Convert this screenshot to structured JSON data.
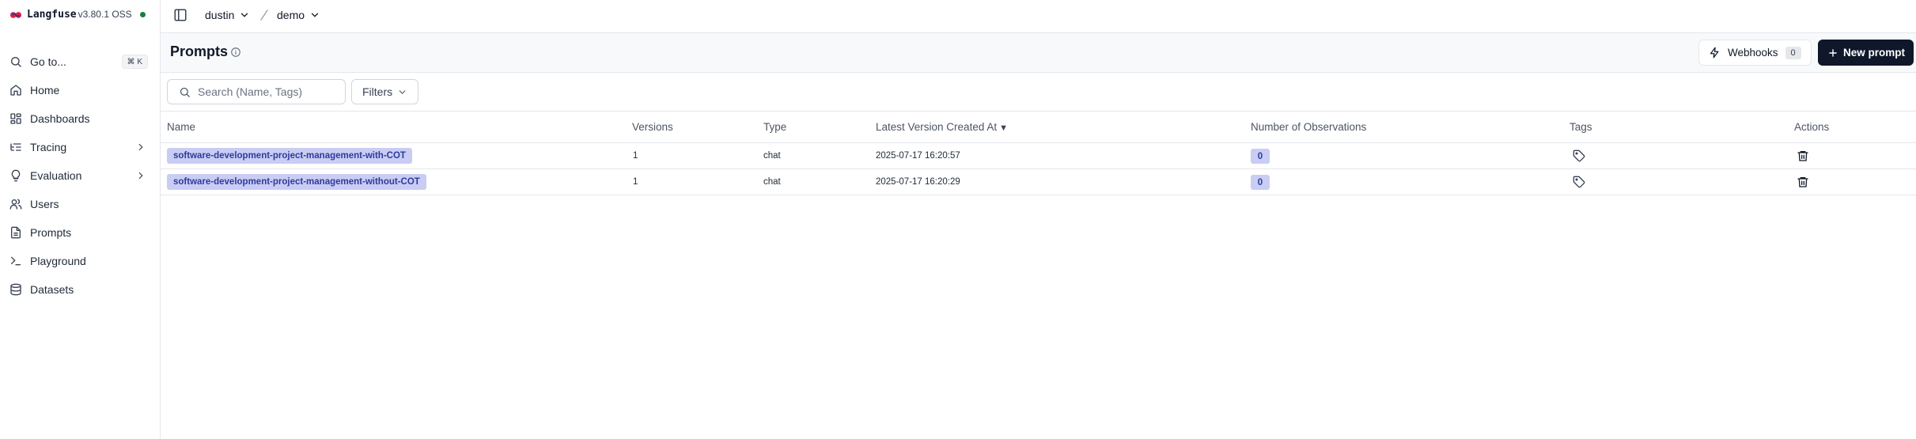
{
  "brand": {
    "name": "Langfuse",
    "version": "v3.80.1 OSS",
    "status_color": "#15803d",
    "logo_colors": [
      "#e11d48",
      "#1e3a8a"
    ]
  },
  "sidebar": {
    "items": [
      {
        "label": "Go to...",
        "icon": "search-icon",
        "shortcut": "⌘ K"
      },
      {
        "label": "Home",
        "icon": "home-icon"
      },
      {
        "label": "Dashboards",
        "icon": "grid-icon"
      },
      {
        "label": "Tracing",
        "icon": "list-tree-icon",
        "expandable": true
      },
      {
        "label": "Evaluation",
        "icon": "lightbulb-icon",
        "expandable": true
      },
      {
        "label": "Users",
        "icon": "users-icon"
      },
      {
        "label": "Prompts",
        "icon": "file-text-icon"
      },
      {
        "label": "Playground",
        "icon": "terminal-icon"
      },
      {
        "label": "Datasets",
        "icon": "database-icon"
      }
    ]
  },
  "topbar": {
    "organization": "dustin",
    "project": "demo"
  },
  "header": {
    "title": "Prompts",
    "webhooks_label": "Webhooks",
    "webhooks_count": "0",
    "new_prompt_label": "New prompt",
    "accent_color": "#0f172a"
  },
  "toolbar": {
    "search_placeholder": "Search (Name, Tags)",
    "search_value": "",
    "filters_label": "Filters"
  },
  "table": {
    "columns": {
      "name": "Name",
      "versions": "Versions",
      "type": "Type",
      "latest": "Latest Version Created At",
      "sort_indicator": "▼",
      "observations": "Number of Observations",
      "tags": "Tags",
      "actions": "Actions"
    },
    "rows": [
      {
        "name": "software-development-project-management-with-COT",
        "versions": "1",
        "type": "chat",
        "latest": "2025-07-17 16:20:57",
        "observations": "0"
      },
      {
        "name": "software-development-project-management-without-COT",
        "versions": "1",
        "type": "chat",
        "latest": "2025-07-17 16:20:29",
        "observations": "0"
      }
    ]
  }
}
